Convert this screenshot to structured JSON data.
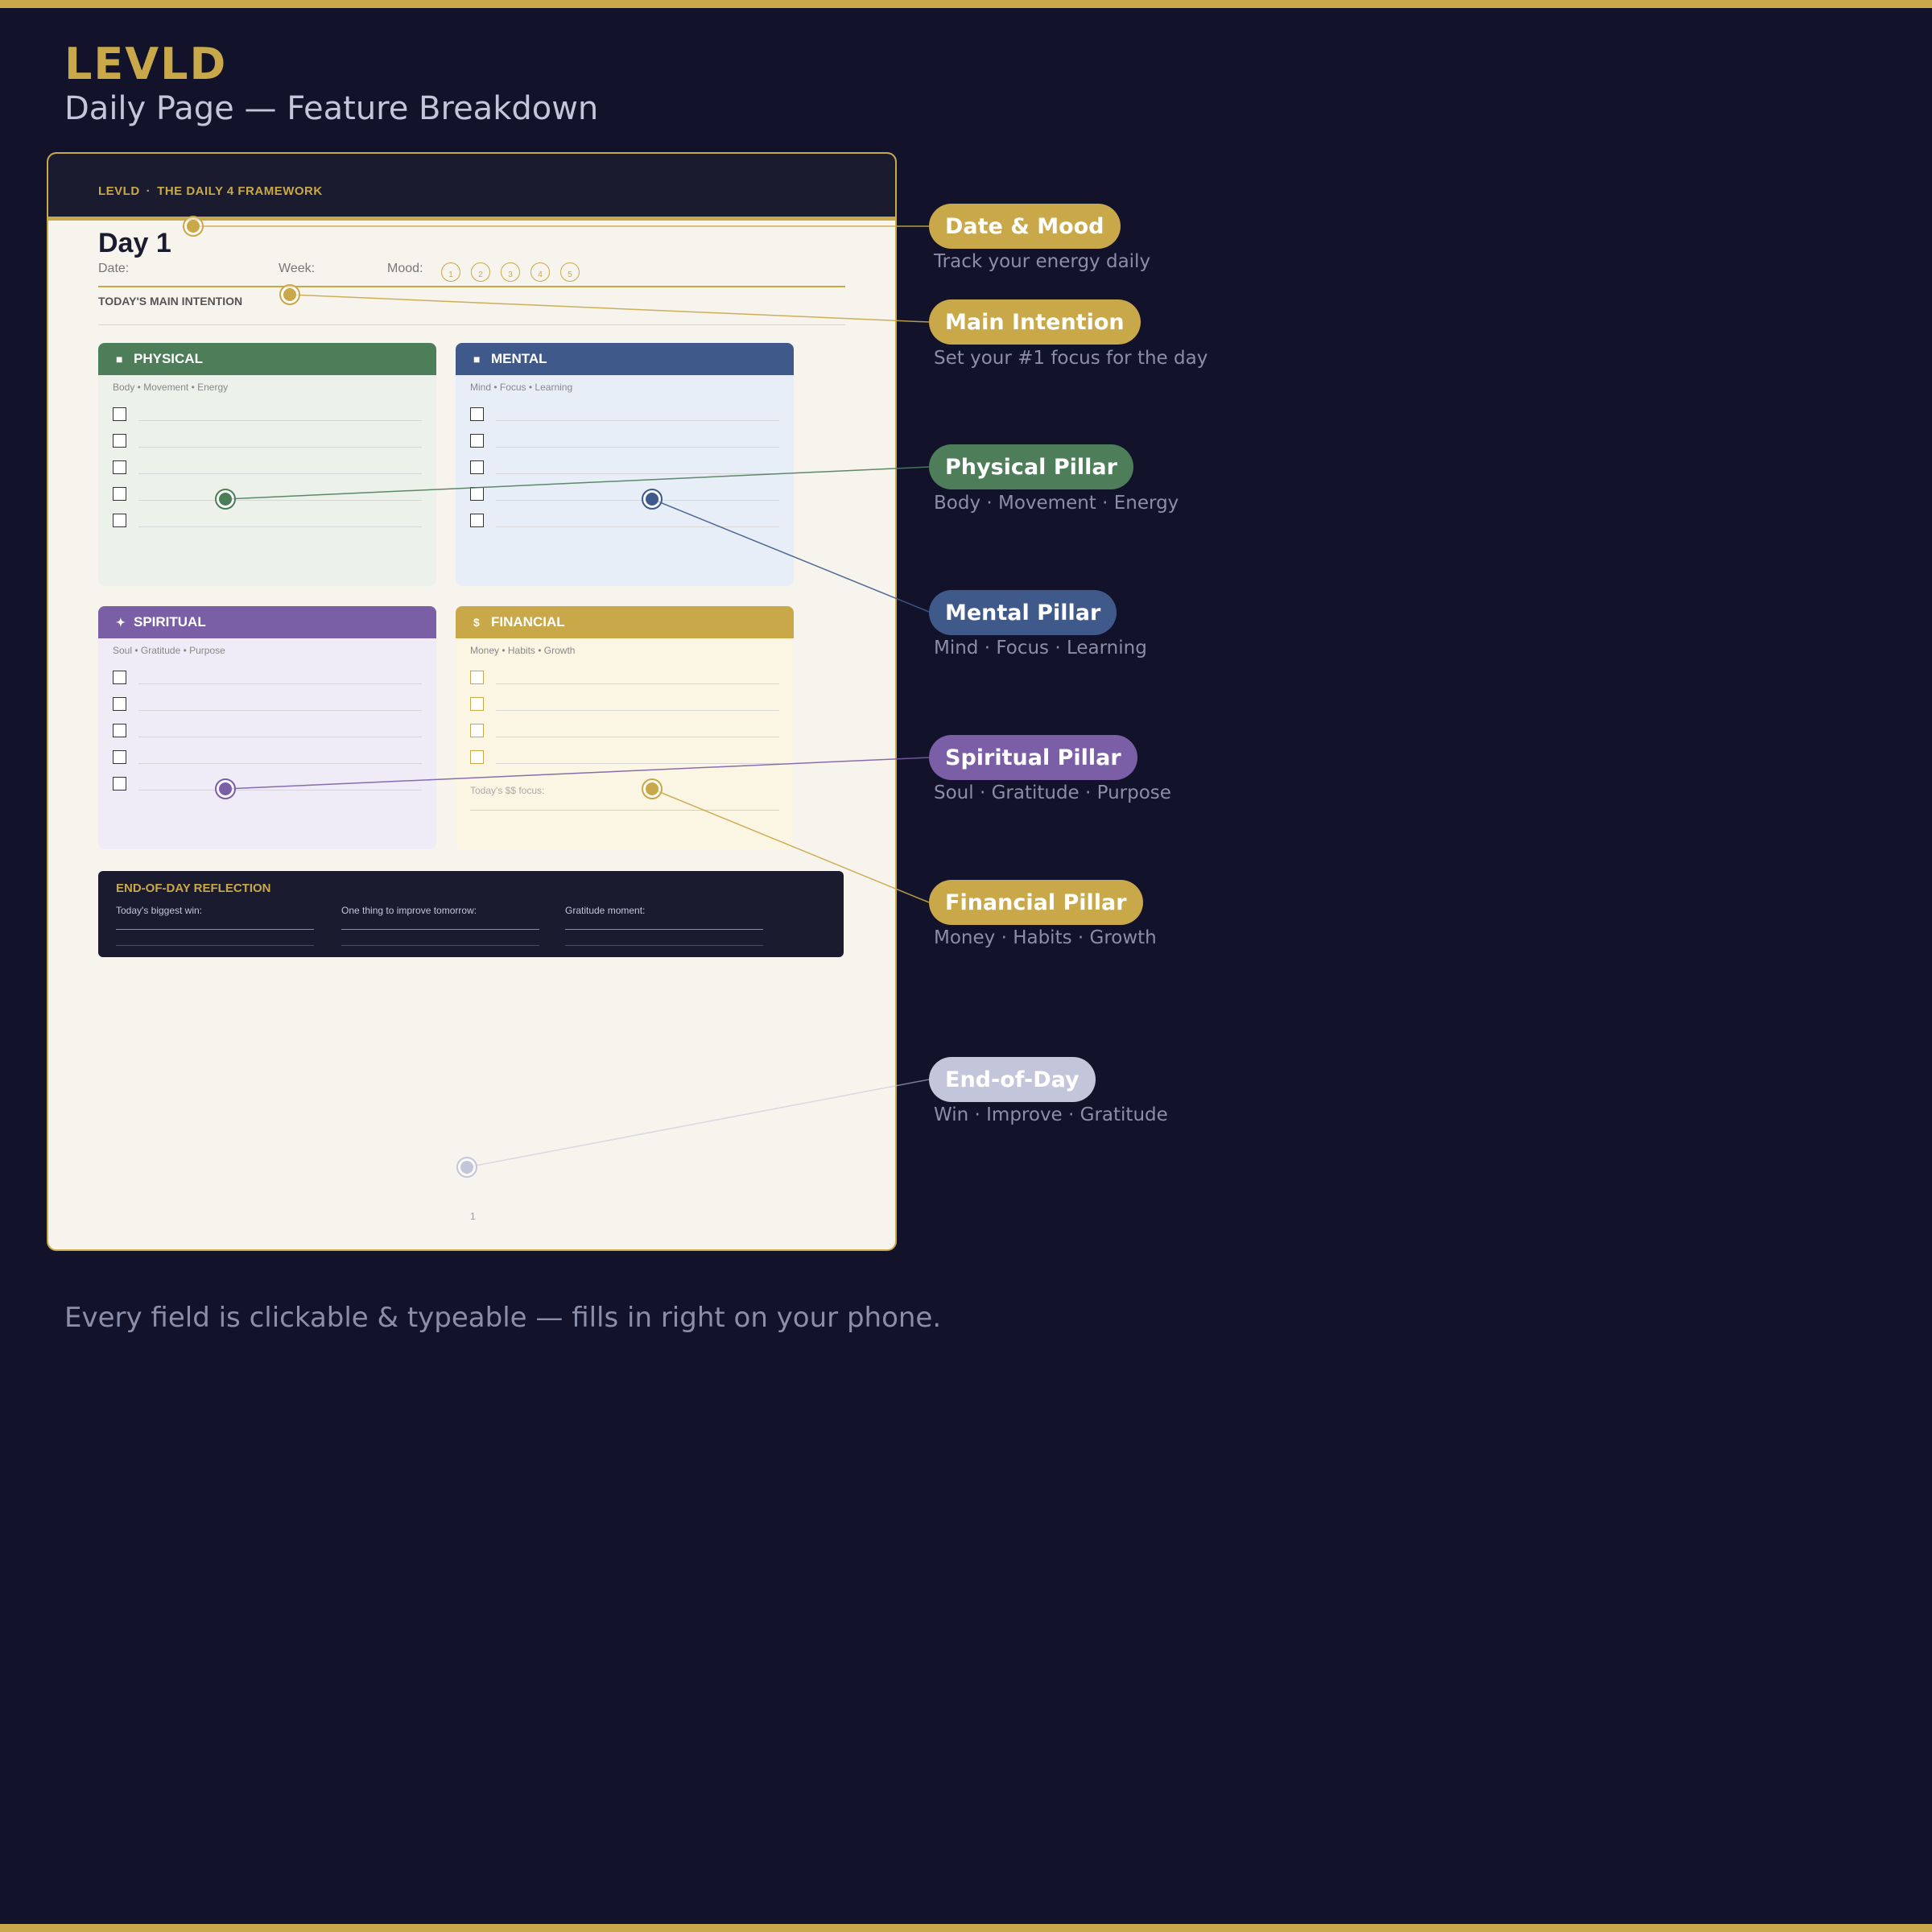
{
  "header": {
    "brand": "LEVLD",
    "subtitle": "Daily Page — Feature Breakdown"
  },
  "page": {
    "brand": "LEVLD",
    "separator": "·",
    "framework": "THE DAILY 4 FRAMEWORK",
    "day_title": "Day 1",
    "date_label": "Date:",
    "week_label": "Week:",
    "mood_label": "Mood:",
    "mood_scale": [
      "1",
      "2",
      "3",
      "4",
      "5"
    ],
    "intention_label": "TODAY'S MAIN INTENTION",
    "pillars": [
      {
        "name": "PHYSICAL",
        "icon": "■",
        "subtitle": "Body • Movement • Energy",
        "color": "#4e7d5a",
        "bg": "#ecf2ea"
      },
      {
        "name": "MENTAL",
        "icon": "■",
        "subtitle": "Mind • Focus • Learning",
        "color": "#3f5a8a",
        "bg": "#e8eef8"
      },
      {
        "name": "SPIRITUAL",
        "icon": "✦",
        "subtitle": "Soul • Gratitude • Purpose",
        "color": "#7b5fa6",
        "bg": "#efebf7"
      },
      {
        "name": "FINANCIAL",
        "icon": "$",
        "subtitle": "Money • Habits • Growth",
        "color": "#c9a84a",
        "bg": "#fbf6e3",
        "focus_label": "Today's $$ focus:"
      }
    ],
    "reflection": {
      "title": "END-OF-DAY REFLECTION",
      "fields": [
        "Today's biggest win:",
        "One thing to improve tomorrow:",
        "Gratitude moment:"
      ]
    },
    "page_number": "1"
  },
  "callouts": [
    {
      "title": "Date & Mood",
      "description": "Track your energy daily",
      "color": "#c9a84a"
    },
    {
      "title": "Main Intention",
      "description": "Set your #1 focus for the day",
      "color": "#c9a84a"
    },
    {
      "title": "Physical Pillar",
      "description": "Body · Movement · Energy",
      "color": "#4e7d5a"
    },
    {
      "title": "Mental Pillar",
      "description": "Mind · Focus · Learning",
      "color": "#3f5a8a"
    },
    {
      "title": "Spiritual Pillar",
      "description": "Soul · Gratitude · Purpose",
      "color": "#7b5fa6"
    },
    {
      "title": "Financial Pillar",
      "description": "Money · Habits · Growth",
      "color": "#c9a84a"
    },
    {
      "title": "End-of-Day",
      "description": "Win · Improve · Gratitude",
      "color": "#c3c6da"
    }
  ],
  "footer": "Every field is clickable & typeable — fills in right on your phone.",
  "colors": {
    "background": "#12132a",
    "accent_gold": "#c9a84a",
    "page_bg": "#f7f4ee",
    "dark_panel": "#1a1b2e"
  }
}
